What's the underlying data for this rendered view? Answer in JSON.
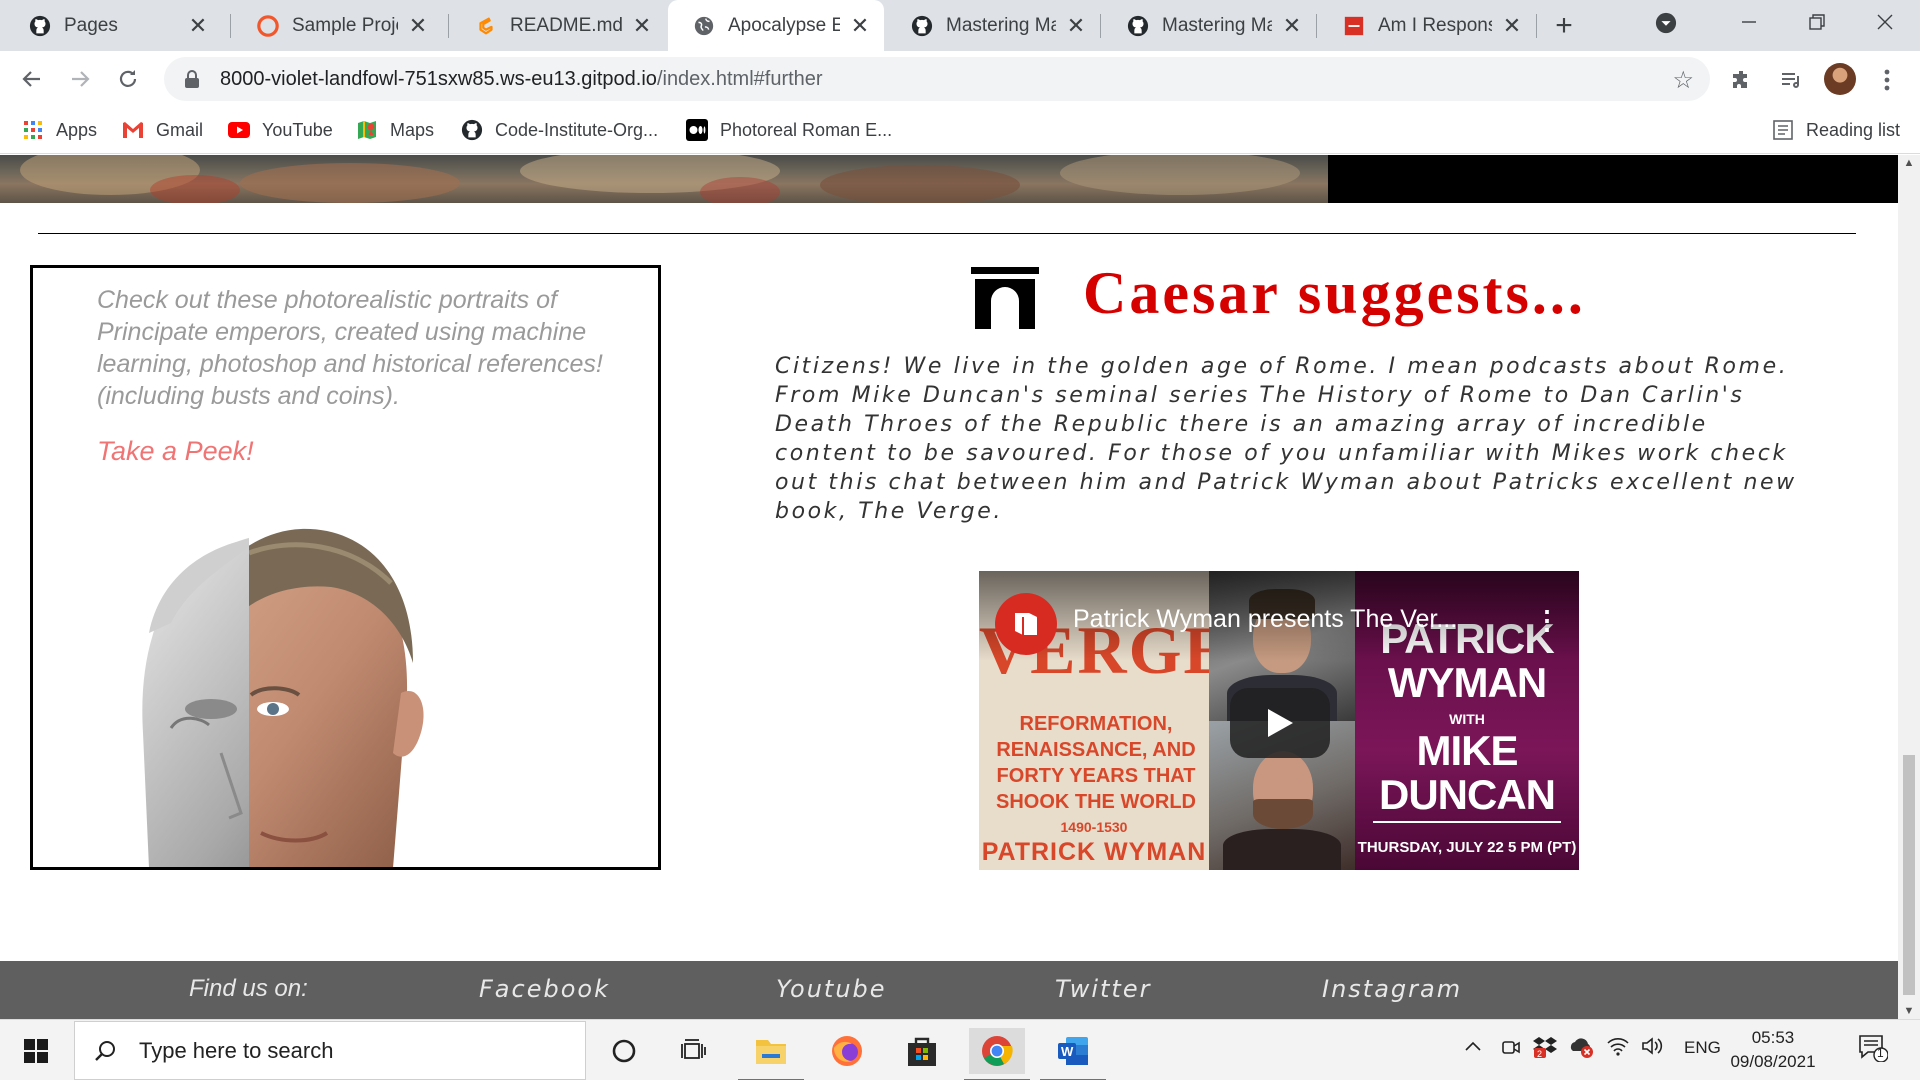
{
  "browser": {
    "tabs": [
      {
        "title": "Pages",
        "icon": "github-icon"
      },
      {
        "title": "Sample Project",
        "icon": "codeanywhere-icon"
      },
      {
        "title": "README.md - ",
        "icon": "gitpod-icon"
      },
      {
        "title": "Apocalypse Eur",
        "icon": "globe-icon",
        "active": true
      },
      {
        "title": "Mastering Mar",
        "icon": "github-icon"
      },
      {
        "title": "Mastering Mar",
        "icon": "github-icon"
      },
      {
        "title": "Am I Responsiv",
        "icon": "amiresponsive-icon"
      }
    ],
    "url_host": "8000-violet-landfowl-751sxw85.ws-eu13.gitpod.io",
    "url_path": "/index.html#further",
    "bookmarks": [
      {
        "label": "Apps",
        "icon": "apps-grid-icon"
      },
      {
        "label": "Gmail",
        "icon": "gmail-icon"
      },
      {
        "label": "YouTube",
        "icon": "youtube-icon"
      },
      {
        "label": "Maps",
        "icon": "maps-icon"
      },
      {
        "label": "Code-Institute-Org...",
        "icon": "github-icon"
      },
      {
        "label": "Photoreal Roman E...",
        "icon": "medium-icon"
      }
    ],
    "reading_list": "Reading list"
  },
  "page": {
    "promo": {
      "text": "Check out these photorealistic portraits of Principate emperors, created using machine learning, photoshop and historical references! (including busts and coins).",
      "link": "Take a Peek!"
    },
    "suggest": {
      "title": "Caesar suggests...",
      "body": "Citizens! We live in the golden age of Rome. I mean podcasts about Rome. From Mike Duncan's seminal series The History of Rome to Dan Carlin's Death Throes of the Republic there is an amazing array of incredible content to be savoured. For those of you unfamiliar with Mikes work check out this chat between him and Patrick Wyman about Patricks excellent new book, The Verge."
    },
    "video": {
      "title": "Patrick Wyman presents The Ver...",
      "cover_title": "VERGE",
      "cover_subtitle": "REFORMATION, RENAISSANCE, AND FORTY YEARS THAT SHOOK THE WORLD",
      "cover_years": "1490-1530",
      "cover_author": "PATRICK WYMAN",
      "poster_name": "PATRICK WYMAN",
      "poster_with": "WITH",
      "poster_guest": "MIKE DUNCAN",
      "poster_date": "THURSDAY, JULY 22 5 PM (PT)"
    },
    "footer": {
      "find_label": "Find us on:",
      "links": [
        "Facebook",
        "Youtube",
        "Twitter",
        "Instagram"
      ]
    }
  },
  "taskbar": {
    "search_placeholder": "Type here to search",
    "language": "ENG",
    "time": "05:53",
    "date": "09/08/2021",
    "notifications": "1"
  },
  "colors": {
    "accent_red": "#d50000",
    "link_pink": "#f07474",
    "footer_bg": "#5f5f5f"
  }
}
